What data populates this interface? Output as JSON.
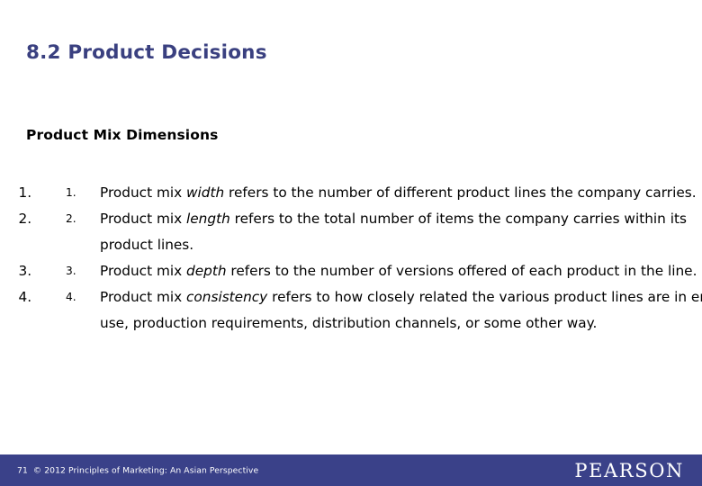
{
  "slide": {
    "title": "8.2 Product Decisions",
    "subtitle": "Product Mix Dimensions",
    "title_color": "#3a4080",
    "subtitle_color": "#000000",
    "background": "#ffffff"
  },
  "list": {
    "items": [
      {
        "number": "1.",
        "segments": [
          {
            "text": "Product mix ",
            "style": "normal"
          },
          {
            "text": "width",
            "style": "italic"
          },
          {
            "text": " refers to the number of different product lines the company carries.",
            "style": "normal"
          }
        ],
        "plain": "Product mix width refers to the number of different product lines the company carries."
      },
      {
        "number": "2.",
        "segments": [
          {
            "text": "Product mix ",
            "style": "normal"
          },
          {
            "text": "length",
            "style": "italic"
          },
          {
            "text": " refers to the total number of items the company carries within its product lines.",
            "style": "normal"
          }
        ],
        "plain": "Product mix length refers to the total number of items the company carries within its product lines."
      },
      {
        "number": "3.",
        "segments": [
          {
            "text": "Product mix ",
            "style": "normal"
          },
          {
            "text": "depth",
            "style": "italic"
          },
          {
            "text": " refers to the number of versions offered of each product in the line.",
            "style": "normal"
          }
        ],
        "plain": "Product mix depth refers to the number of versions offered of each product in the line."
      },
      {
        "number": "4.",
        "segments": [
          {
            "text": "Product mix ",
            "style": "normal"
          },
          {
            "text": "consistency",
            "style": "italic"
          },
          {
            "text": " refers to how closely related the various product lines are in end use, production requirements, distribution channels, or some other way.",
            "style": "normal"
          }
        ],
        "plain": "Product mix consistency refers to how closely related the various product lines are in end use, production requirements, distribution channels, or some other way."
      }
    ]
  },
  "footer": {
    "page_number": "71",
    "copyright": "© 2012 Principles of Marketing: An Asian Perspective",
    "logo_text": "PEARSON",
    "bar_color": "#3a4189",
    "text_color": "#ffffff"
  }
}
